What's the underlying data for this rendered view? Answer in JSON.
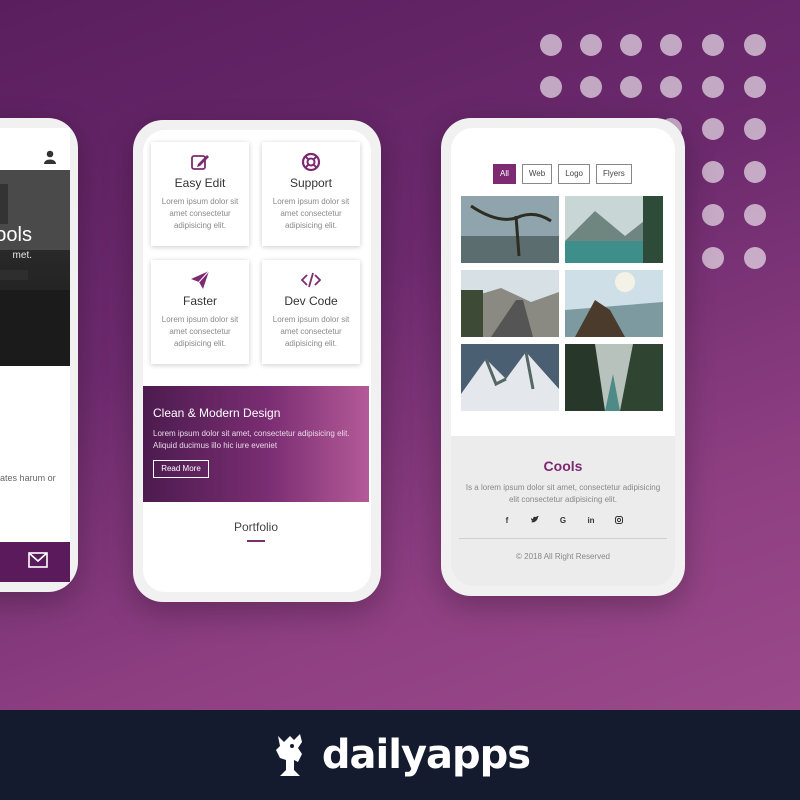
{
  "colors": {
    "accent": "#7d2a72",
    "background": "#6c2a6d",
    "footer": "#151b2e"
  },
  "phone_left": {
    "hero_title": "ools",
    "hero_subtitle": "met.",
    "body_text": "ur adipisicing elit. uptates harum or",
    "icons": {
      "user": "user-icon",
      "mail": "mail-icon"
    }
  },
  "phone_center": {
    "features": [
      {
        "title": "Easy Edit",
        "desc": "Lorem ipsum dolor sit amet consectetur adipisicing elit.",
        "icon": "edit-icon"
      },
      {
        "title": "Support",
        "desc": "Lorem ipsum dolor sit amet consectetur adipisicing elit.",
        "icon": "lifebuoy-icon"
      },
      {
        "title": "Faster",
        "desc": "Lorem ipsum dolor sit amet consectetur adipisicing elit.",
        "icon": "paper-plane-icon"
      },
      {
        "title": "Dev Code",
        "desc": "Lorem ipsum dolor sit amet consectetur adipisicing elit.",
        "icon": "code-icon"
      }
    ],
    "banner": {
      "title": "Clean & Modern Design",
      "desc": "Lorem ipsum dolor sit amet, consectetur adipisicing elit. Aliquid ducimus illo hic iure eveniet",
      "button": "Read More"
    },
    "section_title": "Portfolio"
  },
  "phone_right": {
    "filters": [
      "All",
      "Web",
      "Logo",
      "Flyers"
    ],
    "active_filter": "All",
    "brand": "Cools",
    "brand_desc": "Is a lorem ipsum dolor sit amet, consectetur adipisicing elit consectetur adipisicing elit.",
    "socials": [
      "f",
      "t",
      "G",
      "in",
      "ig"
    ],
    "copyright": "© 2018 All Right Reserved"
  },
  "footer": {
    "brand": "dailyapps",
    "logo_icon": "dailyapps-logo-icon"
  }
}
